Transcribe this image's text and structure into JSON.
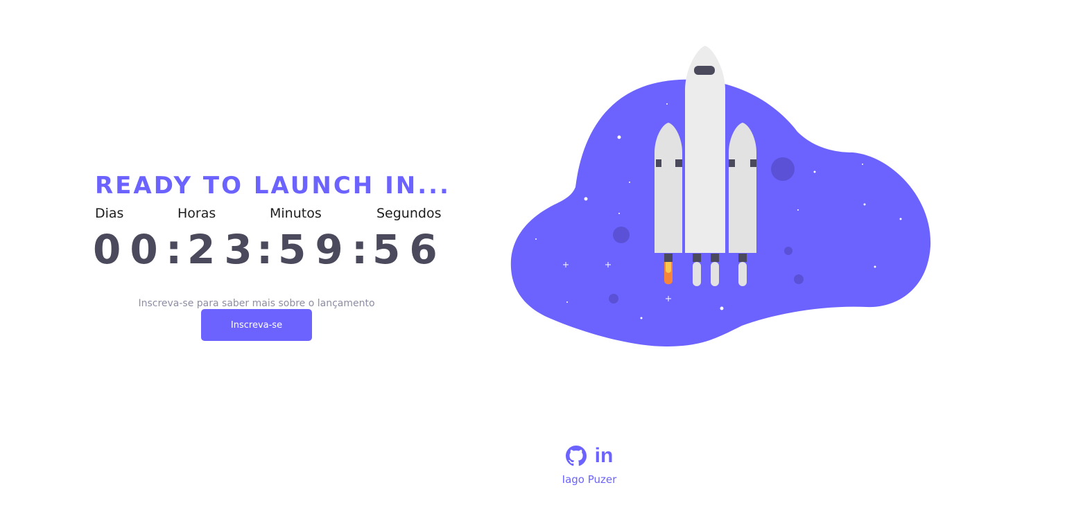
{
  "headline": "READY TO LAUNCH IN...",
  "countdown": {
    "labels": {
      "days": "Dias",
      "hours": "Horas",
      "minutes": "Minutos",
      "seconds": "Segundos"
    },
    "values": {
      "days": "00",
      "hours": "23",
      "minutes": "59",
      "seconds": "56"
    },
    "separator": ":"
  },
  "subscribe": {
    "text": "Inscreva-se para saber mais sobre o lançamento",
    "button_label": "Inscreva-se"
  },
  "footer": {
    "social_icons": [
      "github-icon",
      "linkedin-icon"
    ],
    "linkedin_label": "in",
    "author": "Iago Puzer"
  },
  "colors": {
    "accent": "#6c63ff",
    "timer_text": "#4a4a5c",
    "muted_text": "#8d8da3"
  }
}
